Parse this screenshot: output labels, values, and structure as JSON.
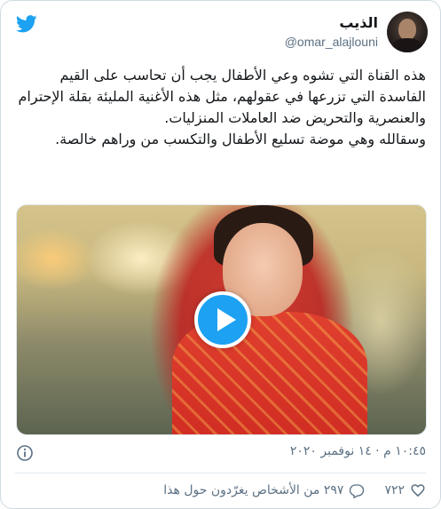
{
  "user": {
    "name": "الذيب",
    "handle": "@omar_alajlouni"
  },
  "tweet": {
    "text_lines": [
      "هذه القناة التي تشوه وعي الأطفال يجب أن تحاسب على القيم الفاسدة التي تزرعها في عقولهم، مثل هذه الأغنية المليئة بقلة الإحترام والعنصرية والتحريض ضد العاملات المنزليات.",
      "وسقالله وهي موضة تسليع الأطفال والتكسب من وراهم خالصة."
    ]
  },
  "media": {
    "type": "video",
    "play_icon": "play-icon"
  },
  "meta": {
    "timestamp": "١٠:٤٥ م · ١٤ نوفمبر ٢٠٢٠",
    "info_icon": "info-icon"
  },
  "actions": {
    "likes": "٧٢٢",
    "replies_text": "٢٩٧ من الأشخاص يغرّدون حول هذا"
  },
  "colors": {
    "accent": "#1da1f2",
    "text": "#14171a",
    "muted": "#5b7083",
    "border": "#cfd9de"
  }
}
